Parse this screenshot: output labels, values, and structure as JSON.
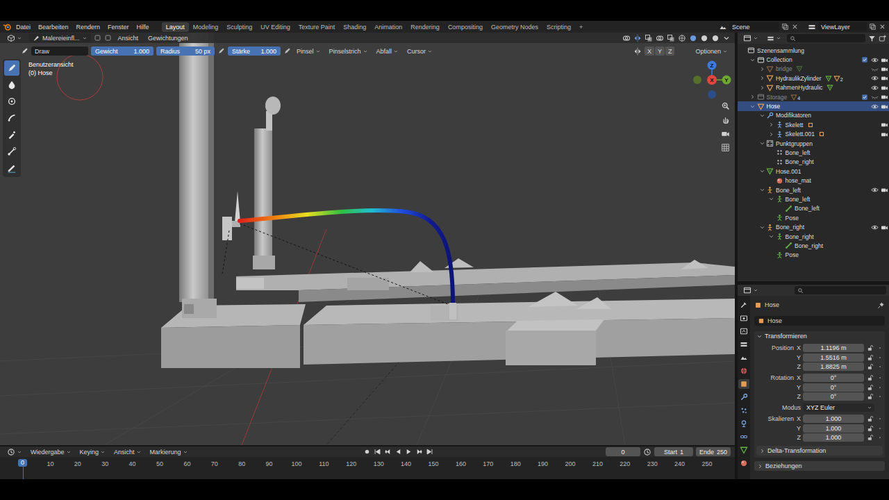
{
  "top_bar": {
    "menus": [
      "Datei",
      "Bearbeiten",
      "Rendern",
      "Fenster",
      "Hilfe"
    ],
    "workspaces": [
      {
        "label": "Layout",
        "selected": true
      },
      {
        "label": "Modeling",
        "selected": false
      },
      {
        "label": "Sculpting",
        "selected": false
      },
      {
        "label": "UV Editing",
        "selected": false
      },
      {
        "label": "Texture Paint",
        "selected": false
      },
      {
        "label": "Shading",
        "selected": false
      },
      {
        "label": "Animation",
        "selected": false
      },
      {
        "label": "Rendering",
        "selected": false
      },
      {
        "label": "Compositing",
        "selected": false
      },
      {
        "label": "Geometry Nodes",
        "selected": false
      },
      {
        "label": "Scripting",
        "selected": false
      }
    ],
    "add_workspace": "+",
    "scene": "Scene",
    "view_layer": "ViewLayer"
  },
  "viewport_header": {
    "mode": "Malereieinfl...",
    "menus": [
      "Ansicht",
      "Gewichtungen"
    ]
  },
  "tool_settings": {
    "tool": "Draw",
    "sliders": [
      {
        "label": "Gewicht",
        "value": "1.000",
        "level": 1
      },
      {
        "label": "Radius",
        "value": "50 px",
        "level": 1
      },
      {
        "label": "Stärke",
        "value": "1.000",
        "level": 1
      }
    ],
    "menus": [
      "Pinsel",
      "Pinselstrich",
      "Abfall",
      "Cursor"
    ],
    "mirror_axes": [
      {
        "label": "X",
        "on": false
      },
      {
        "label": "Y",
        "on": false
      },
      {
        "label": "Z",
        "on": false
      }
    ],
    "options": "Optionen"
  },
  "viewport": {
    "view_name": "Benutzeransicht",
    "object_info": "(0) Hose",
    "tools": [
      {
        "kind": "draw",
        "selected": true
      },
      {
        "kind": "blur",
        "selected": false
      },
      {
        "kind": "average",
        "selected": false
      },
      {
        "kind": "smear",
        "selected": false
      },
      {
        "kind": "sample",
        "selected": false
      },
      {
        "kind": "gradient",
        "selected": false
      },
      {
        "kind": "annotate",
        "selected": false
      }
    ],
    "gizmo": {
      "x": "X",
      "y": "Y",
      "z": "Z"
    }
  },
  "outliner": {
    "items": [
      {
        "name": "Szenensammlung",
        "depth": 0,
        "kind": "scene_collection",
        "selected": false,
        "dimmed": false
      },
      {
        "name": "Collection",
        "depth": 1,
        "kind": "collection",
        "expanded": true,
        "selected": false,
        "dimmed": false,
        "checkbox": true,
        "eye": true,
        "camera": true
      },
      {
        "name": "bridge",
        "depth": 2,
        "kind": "mesh",
        "expanded": false,
        "selected": false,
        "dimmed": true,
        "extras": [
          "mesh_data"
        ],
        "eye": false,
        "camera": true
      },
      {
        "name": "HydraulikZylinder",
        "depth": 2,
        "kind": "mesh",
        "expanded": false,
        "selected": false,
        "dimmed": false,
        "extras": [
          "mesh_data",
          "mesh"
        ],
        "badge": "2",
        "eye": true,
        "camera": true
      },
      {
        "name": "RahmenHydraulic",
        "depth": 2,
        "kind": "mesh",
        "expanded": false,
        "selected": false,
        "dimmed": false,
        "extras": [
          "mesh_data"
        ],
        "eye": true,
        "camera": true
      },
      {
        "name": "Storage",
        "depth": 1,
        "kind": "collection",
        "expanded": false,
        "selected": false,
        "dimmed": true,
        "extras": [
          "mesh"
        ],
        "badge": "4",
        "checkbox": true,
        "eye": false,
        "camera": true
      },
      {
        "name": "Hose",
        "depth": 1,
        "kind": "mesh",
        "expanded": true,
        "selected": true,
        "dimmed": false,
        "eye": true,
        "camera": true
      },
      {
        "name": "Modifikatoren",
        "depth": 2,
        "kind": "modifiers",
        "expanded": true,
        "selected": false,
        "dimmed": false
      },
      {
        "name": "Skelett",
        "depth": 3,
        "kind": "armature_mod",
        "expanded": false,
        "selected": false,
        "dimmed": false,
        "extras": [
          "object_link"
        ],
        "camera": true
      },
      {
        "name": "Skelett.001",
        "depth": 3,
        "kind": "armature_mod",
        "expanded": false,
        "selected": false,
        "dimmed": false,
        "extras": [
          "object_link"
        ],
        "camera": true
      },
      {
        "name": "Punktgruppen",
        "depth": 2,
        "kind": "vertex_groups",
        "expanded": true,
        "selected": false,
        "dimmed": false
      },
      {
        "name": "Bone_left",
        "depth": 3,
        "kind": "vertex_group",
        "selected": false,
        "dimmed": false
      },
      {
        "name": "Bone_right",
        "depth": 3,
        "kind": "vertex_group",
        "selected": false,
        "dimmed": false
      },
      {
        "name": "Hose.001",
        "depth": 2,
        "kind": "mesh_data",
        "expanded": true,
        "selected": false,
        "dimmed": false
      },
      {
        "name": "hose_mat",
        "depth": 3,
        "kind": "material",
        "selected": false,
        "dimmed": false
      },
      {
        "name": "Bone_left",
        "depth": 2,
        "kind": "armature",
        "expanded": true,
        "selected": false,
        "dimmed": false,
        "eye": true,
        "camera": true
      },
      {
        "name": "Bone_left",
        "depth": 3,
        "kind": "armature_data",
        "expanded": true,
        "selected": false,
        "dimmed": false
      },
      {
        "name": "Bone_left",
        "depth": 4,
        "kind": "bone",
        "selected": false,
        "dimmed": false
      },
      {
        "name": "Pose",
        "depth": 3,
        "kind": "pose",
        "selected": false,
        "dimmed": false
      },
      {
        "name": "Bone_right",
        "depth": 2,
        "kind": "armature",
        "expanded": true,
        "selected": false,
        "dimmed": false,
        "eye": true,
        "camera": true
      },
      {
        "name": "Bone_right",
        "depth": 3,
        "kind": "armature_data",
        "expanded": true,
        "selected": false,
        "dimmed": false
      },
      {
        "name": "Bone_right",
        "depth": 4,
        "kind": "bone",
        "selected": false,
        "dimmed": false
      },
      {
        "name": "Pose",
        "depth": 3,
        "kind": "pose",
        "selected": false,
        "dimmed": false
      }
    ]
  },
  "properties": {
    "tabs": [
      {
        "kind": "tool",
        "selected": false
      },
      {
        "kind": "render",
        "selected": false
      },
      {
        "kind": "output",
        "selected": false
      },
      {
        "kind": "view_layer",
        "selected": false
      },
      {
        "kind": "scene",
        "selected": false
      },
      {
        "kind": "world",
        "selected": false
      },
      {
        "kind": "object",
        "selected": true
      },
      {
        "kind": "modifier",
        "selected": false
      },
      {
        "kind": "particles",
        "selected": false
      },
      {
        "kind": "physics",
        "selected": false
      },
      {
        "kind": "constraints",
        "selected": false
      },
      {
        "kind": "data",
        "selected": false
      },
      {
        "kind": "material",
        "selected": false
      }
    ],
    "object_name": "Hose",
    "name_field": "Hose",
    "panel": {
      "title": "Transformieren",
      "expanded": true,
      "groups": [
        {
          "label": "Position",
          "rows": [
            {
              "axis": "X",
              "value": "1.1196 m",
              "locked": false
            },
            {
              "axis": "Y",
              "value": "1.5516 m",
              "locked": false
            },
            {
              "axis": "Z",
              "value": "1.8825 m",
              "locked": false
            }
          ]
        },
        {
          "label": "Rotation",
          "rows": [
            {
              "axis": "X",
              "value": "0°",
              "locked": false
            },
            {
              "axis": "Y",
              "value": "0°",
              "locked": false
            },
            {
              "axis": "Z",
              "value": "0°",
              "locked": false
            }
          ]
        },
        {
          "label": "Modus",
          "kind": "dropdown",
          "value": "XYZ Euler"
        },
        {
          "label": "Skalieren",
          "rows": [
            {
              "axis": "X",
              "value": "1.000",
              "locked": false
            },
            {
              "axis": "Y",
              "value": "1.000",
              "locked": false
            },
            {
              "axis": "Z",
              "value": "1.000",
              "locked": false
            }
          ]
        }
      ],
      "subpanels": [
        {
          "title": "Delta-Transformation",
          "expanded": false
        }
      ]
    },
    "panels_collapsed": [
      {
        "title": "Beziehungen",
        "expanded": false
      }
    ]
  },
  "timeline": {
    "menus": [
      "Wiedergabe",
      "Keying",
      "Ansicht",
      "Markierung"
    ],
    "current_frame": "0",
    "start_label": "Start",
    "start": "1",
    "end_label": "Ende",
    "end": "250",
    "ruler": [
      "10",
      "20",
      "30",
      "40",
      "50",
      "60",
      "70",
      "80",
      "90",
      "100",
      "110",
      "120",
      "130",
      "140",
      "150",
      "160",
      "170",
      "180",
      "190",
      "200",
      "210",
      "220",
      "230",
      "240",
      "250"
    ],
    "playhead": "0"
  }
}
